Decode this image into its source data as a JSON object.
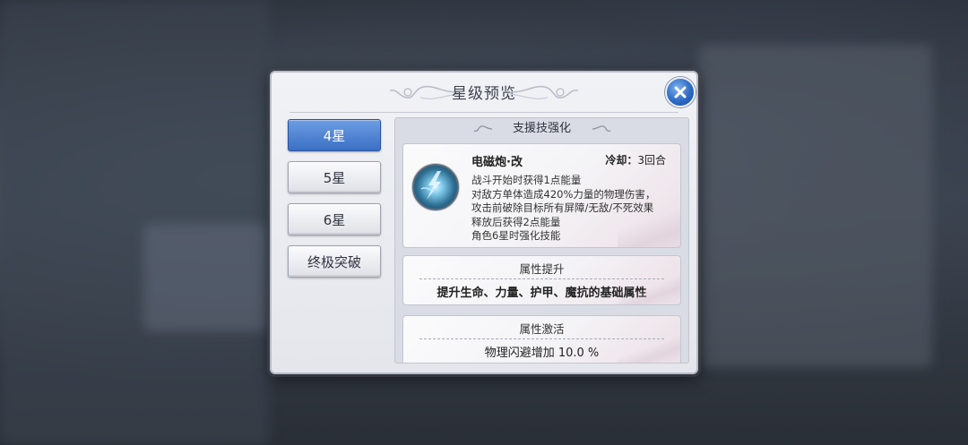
{
  "dialog": {
    "title": "星级预览",
    "close_icon": "close-icon"
  },
  "tabs": [
    {
      "label": "4星",
      "active": true
    },
    {
      "label": "5星",
      "active": false
    },
    {
      "label": "6星",
      "active": false
    },
    {
      "label": "终极突破",
      "active": false
    }
  ],
  "panel": {
    "header": "支援技强化",
    "skill": {
      "name": "电磁炮·改",
      "cooldown_label": "冷却：",
      "cooldown_value": "3回合",
      "icon": "lightning-skill-icon",
      "description": [
        "战斗开始时获得1点能量",
        "对敌方单体造成420%力量的物理伤害，",
        "攻击前破除目标所有屏障/无敌/不死效果",
        "释放后获得2点能量",
        "角色6星时强化技能"
      ]
    },
    "sections": [
      {
        "title": "属性提升",
        "body": "提升生命、力量、护甲、魔抗的基础属性"
      },
      {
        "title": "属性激活",
        "body": "物理闪避增加 10.0 %"
      }
    ]
  },
  "colors": {
    "active_tab": "#3a6fc4",
    "close_button": "#2d6ac5",
    "dialog_bg": "#eceef2"
  }
}
